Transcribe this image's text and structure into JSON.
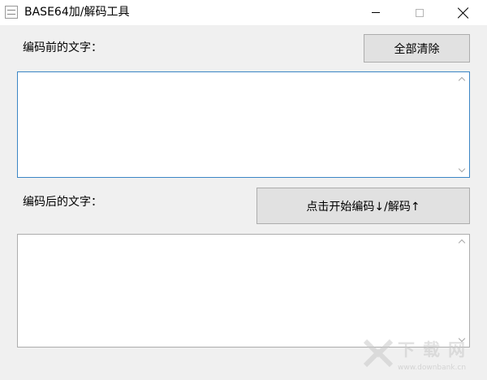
{
  "window": {
    "title": "BASE64加/解码工具",
    "icon": "app-icon"
  },
  "main": {
    "input_label": "编码前的文字：",
    "clear_button_label": "全部清除",
    "input_text": "",
    "output_label": "编码后的文字：",
    "convert_button_label": "点击开始编码↓/解码↑",
    "output_text": ""
  },
  "watermark": {
    "title": "下载网",
    "url": "www.downbank.cn"
  },
  "colors": {
    "focus_border": "#3b86c5",
    "button_bg": "#e1e1e1",
    "window_bg": "#f0f0f0"
  }
}
